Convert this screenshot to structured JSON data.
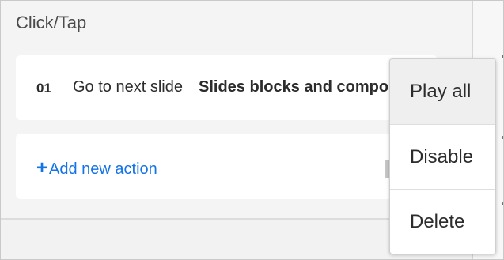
{
  "section": {
    "title": "Click/Tap"
  },
  "actions": [
    {
      "index": "01",
      "description": "Go to next slide",
      "target": "Slides blocks and compo"
    }
  ],
  "add_action": {
    "icon": "plus-icon",
    "plus": "+",
    "label": "Add new action"
  },
  "context_menu": {
    "items": [
      {
        "label": "Play all",
        "state": "hovered"
      },
      {
        "label": "Disable"
      },
      {
        "label": "Delete"
      }
    ]
  },
  "colors": {
    "link": "#1473e6",
    "panel_background": "#f4f4f4",
    "card_background": "#ffffff",
    "menu_hover": "#efefef",
    "text": "#2c2c2c"
  }
}
